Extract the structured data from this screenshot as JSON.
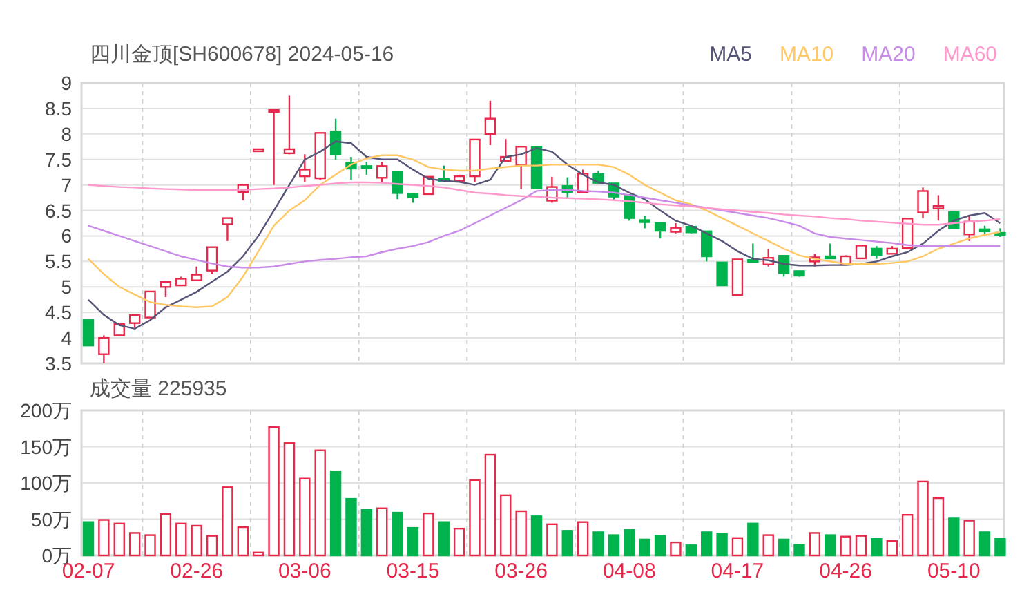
{
  "title": "四川金顶[SH600678] 2024-05-16",
  "price_chart": {
    "chart_data": {
      "type": "candlestick",
      "grid": true,
      "ylim": [
        3.5,
        9
      ],
      "yticks": [
        3.5,
        4,
        4.5,
        5,
        5.5,
        6,
        6.5,
        7,
        7.5,
        8,
        8.5,
        9
      ],
      "ohlc": [
        [
          4.35,
          4.35,
          3.85,
          3.85
        ],
        [
          3.68,
          4.05,
          3.5,
          4.0
        ],
        [
          4.05,
          4.27,
          4.05,
          4.27
        ],
        [
          4.29,
          4.45,
          4.2,
          4.45
        ],
        [
          4.4,
          4.91,
          4.4,
          4.91
        ],
        [
          5.0,
          5.1,
          4.8,
          5.1
        ],
        [
          5.03,
          5.2,
          5.03,
          5.16
        ],
        [
          5.13,
          5.4,
          5.13,
          5.24
        ],
        [
          5.32,
          5.78,
          5.25,
          5.78
        ],
        [
          6.23,
          6.35,
          5.9,
          6.35
        ],
        [
          6.86,
          7.0,
          6.7,
          7.0
        ],
        [
          7.7,
          7.7,
          7.7,
          7.7
        ],
        [
          8.45,
          8.47,
          7.0,
          8.47
        ],
        [
          7.62,
          8.75,
          7.6,
          7.7
        ],
        [
          7.17,
          7.6,
          7.05,
          7.3
        ],
        [
          7.13,
          8.02,
          7.1,
          8.02
        ],
        [
          8.05,
          8.3,
          7.5,
          7.6
        ],
        [
          7.44,
          7.55,
          7.1,
          7.32
        ],
        [
          7.37,
          7.45,
          7.2,
          7.33
        ],
        [
          7.14,
          7.45,
          7.05,
          7.37
        ],
        [
          7.25,
          7.25,
          6.72,
          6.84
        ],
        [
          6.83,
          6.83,
          6.65,
          6.76
        ],
        [
          6.82,
          7.16,
          6.82,
          7.16
        ],
        [
          7.12,
          7.38,
          7.05,
          7.1
        ],
        [
          7.08,
          7.2,
          7.05,
          7.17
        ],
        [
          7.17,
          7.89,
          7.05,
          7.89
        ],
        [
          8.0,
          8.65,
          7.78,
          8.3
        ],
        [
          7.47,
          7.9,
          7.47,
          7.55
        ],
        [
          7.39,
          7.75,
          6.92,
          7.75
        ],
        [
          7.75,
          7.75,
          6.93,
          6.93
        ],
        [
          6.69,
          7.16,
          6.65,
          6.96
        ],
        [
          6.98,
          7.15,
          6.75,
          6.86
        ],
        [
          6.86,
          7.3,
          6.86,
          7.22
        ],
        [
          7.21,
          7.28,
          7.04,
          7.04
        ],
        [
          7.03,
          7.03,
          6.7,
          6.77
        ],
        [
          6.8,
          6.8,
          6.3,
          6.35
        ],
        [
          6.31,
          6.4,
          6.15,
          6.27
        ],
        [
          6.25,
          6.25,
          5.95,
          6.1
        ],
        [
          6.08,
          6.25,
          6.05,
          6.16
        ],
        [
          6.18,
          6.2,
          6.05,
          6.07
        ],
        [
          6.09,
          6.09,
          5.5,
          5.6
        ],
        [
          5.48,
          5.48,
          5.03,
          5.03
        ],
        [
          4.84,
          5.54,
          4.84,
          5.54
        ],
        [
          5.53,
          5.85,
          5.5,
          5.51
        ],
        [
          5.44,
          5.75,
          5.4,
          5.57
        ],
        [
          5.61,
          5.62,
          5.2,
          5.27
        ],
        [
          5.31,
          5.31,
          5.2,
          5.22
        ],
        [
          5.5,
          5.65,
          5.4,
          5.58
        ],
        [
          5.6,
          5.85,
          5.55,
          5.57
        ],
        [
          5.44,
          5.62,
          5.44,
          5.6
        ],
        [
          5.56,
          5.81,
          5.56,
          5.81
        ],
        [
          5.75,
          5.8,
          5.55,
          5.63
        ],
        [
          5.65,
          5.8,
          5.65,
          5.75
        ],
        [
          5.76,
          6.34,
          5.76,
          6.34
        ],
        [
          6.46,
          6.95,
          6.35,
          6.88
        ],
        [
          6.54,
          6.8,
          6.3,
          6.59
        ],
        [
          6.47,
          6.47,
          6.15,
          6.15
        ],
        [
          6.03,
          6.4,
          5.9,
          6.28
        ],
        [
          6.13,
          6.2,
          6.0,
          6.11
        ],
        [
          6.06,
          6.15,
          5.98,
          6.02
        ]
      ]
    },
    "moving_averages": {
      "chart_data": {
        "type": "line",
        "ylim": [
          3.5,
          9
        ],
        "series": [
          {
            "name": "MA5",
            "color": "#555577",
            "values": [
              4.75,
              4.45,
              4.25,
              4.18,
              4.35,
              4.6,
              4.75,
              4.9,
              5.1,
              5.3,
              5.6,
              6.0,
              6.5,
              7.0,
              7.5,
              7.65,
              7.85,
              7.82,
              7.55,
              7.5,
              7.5,
              7.3,
              7.12,
              7.08,
              7.06,
              7.0,
              7.1,
              7.55,
              7.6,
              7.72,
              7.65,
              7.4,
              7.2,
              7.05,
              7.0,
              6.85,
              6.72,
              6.5,
              6.3,
              6.2,
              6.05,
              5.9,
              5.7,
              5.55,
              5.52,
              5.45,
              5.42,
              5.42,
              5.43,
              5.43,
              5.45,
              5.5,
              5.6,
              5.68,
              5.85,
              6.1,
              6.3,
              6.4,
              6.45,
              6.25
            ]
          },
          {
            "name": "MA10",
            "color": "#ffc864",
            "values": [
              5.55,
              5.25,
              5.0,
              4.85,
              4.7,
              4.65,
              4.62,
              4.6,
              4.62,
              4.8,
              5.2,
              5.7,
              6.2,
              6.5,
              6.7,
              7.0,
              7.2,
              7.4,
              7.52,
              7.58,
              7.58,
              7.5,
              7.35,
              7.3,
              7.28,
              7.28,
              7.32,
              7.35,
              7.38,
              7.38,
              7.4,
              7.4,
              7.4,
              7.4,
              7.35,
              7.2,
              7.0,
              6.85,
              6.7,
              6.62,
              6.5,
              6.35,
              6.2,
              6.05,
              5.9,
              5.75,
              5.62,
              5.55,
              5.5,
              5.45,
              5.45,
              5.45,
              5.47,
              5.5,
              5.6,
              5.75,
              5.85,
              5.95,
              6.02,
              6.08
            ]
          },
          {
            "name": "MA20",
            "color": "#c98be8",
            "values": [
              6.2,
              6.1,
              6.0,
              5.9,
              5.8,
              5.7,
              5.6,
              5.53,
              5.46,
              5.4,
              5.38,
              5.38,
              5.4,
              5.45,
              5.5,
              5.53,
              5.55,
              5.58,
              5.6,
              5.68,
              5.75,
              5.8,
              5.88,
              6.0,
              6.1,
              6.25,
              6.4,
              6.55,
              6.7,
              6.88,
              6.9,
              6.9,
              6.88,
              6.87,
              6.85,
              6.8,
              6.75,
              6.7,
              6.65,
              6.6,
              6.55,
              6.5,
              6.45,
              6.4,
              6.35,
              6.28,
              6.2,
              6.05,
              5.98,
              5.95,
              5.92,
              5.89,
              5.86,
              5.82,
              5.8,
              5.8,
              5.8,
              5.8,
              5.8,
              5.8
            ]
          },
          {
            "name": "MA60",
            "color": "#ff99cc",
            "values": [
              7.0,
              6.98,
              6.96,
              6.95,
              6.93,
              6.92,
              6.91,
              6.9,
              6.9,
              6.9,
              6.9,
              6.92,
              6.93,
              6.95,
              6.98,
              7.0,
              7.03,
              7.05,
              7.05,
              7.04,
              7.02,
              7.0,
              6.98,
              6.95,
              6.9,
              6.85,
              6.83,
              6.8,
              6.78,
              6.77,
              6.75,
              6.74,
              6.73,
              6.72,
              6.7,
              6.68,
              6.65,
              6.62,
              6.6,
              6.58,
              6.55,
              6.52,
              6.5,
              6.47,
              6.45,
              6.42,
              6.4,
              6.38,
              6.35,
              6.33,
              6.3,
              6.28,
              6.26,
              6.24,
              6.22,
              6.22,
              6.25,
              6.28,
              6.3,
              6.33
            ]
          }
        ]
      }
    }
  },
  "volume_chart": {
    "title": "成交量 225935",
    "chart_data": {
      "type": "bar",
      "grid": true,
      "ylim": [
        0,
        200
      ],
      "yticks": [
        {
          "value": 0,
          "label": "0万"
        },
        {
          "value": 50,
          "label": "50万"
        },
        {
          "value": 100,
          "label": "100万"
        },
        {
          "value": 150,
          "label": "150万"
        },
        {
          "value": 200,
          "label": "200万"
        }
      ],
      "categories": [
        "02-07",
        null,
        null,
        null,
        null,
        null,
        null,
        "02-26",
        null,
        null,
        null,
        null,
        null,
        null,
        "03-06",
        null,
        null,
        null,
        null,
        null,
        null,
        "03-15",
        null,
        null,
        null,
        null,
        null,
        null,
        "03-26",
        null,
        null,
        null,
        null,
        null,
        null,
        "04-08",
        null,
        null,
        null,
        null,
        null,
        null,
        "04-17",
        null,
        null,
        null,
        null,
        null,
        null,
        "04-26",
        null,
        null,
        null,
        null,
        null,
        null,
        "05-10",
        null,
        null,
        null
      ],
      "values": [
        46,
        49,
        44,
        31,
        28,
        57,
        44,
        41,
        27,
        94,
        39,
        4,
        177,
        155,
        106,
        145,
        116,
        78,
        63,
        65,
        59,
        38,
        58,
        46,
        37,
        104,
        139,
        83,
        61,
        54,
        43,
        34,
        46,
        32,
        28,
        35,
        22,
        27,
        18,
        14,
        32,
        30,
        24,
        44,
        28,
        22,
        15,
        31,
        28,
        26,
        27,
        23,
        20,
        56,
        102,
        79,
        51,
        48,
        32,
        23
      ]
    }
  }
}
